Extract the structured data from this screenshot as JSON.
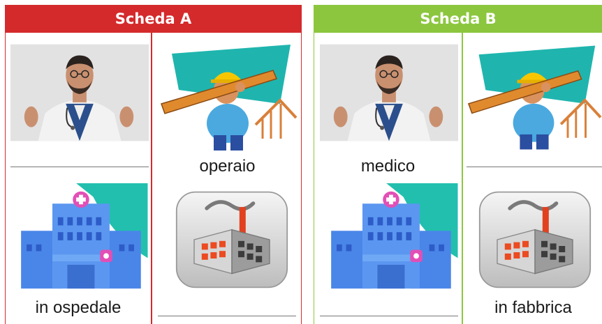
{
  "sheet_a": {
    "title": "Scheda A",
    "accent_color": "#d42a2c",
    "cells": [
      {
        "image": "doctor-photo",
        "word": ""
      },
      {
        "image": "worker-icon",
        "word": "operaio"
      },
      {
        "image": "hospital-icon",
        "word": "in ospedale"
      },
      {
        "image": "factory-icon",
        "word": ""
      }
    ]
  },
  "sheet_b": {
    "title": "Scheda B",
    "accent_color": "#8cc63f",
    "cells": [
      {
        "image": "doctor-photo",
        "word": "medico"
      },
      {
        "image": "worker-icon",
        "word": ""
      },
      {
        "image": "hospital-icon",
        "word": ""
      },
      {
        "image": "factory-icon",
        "word": "in fabbrica"
      }
    ]
  }
}
